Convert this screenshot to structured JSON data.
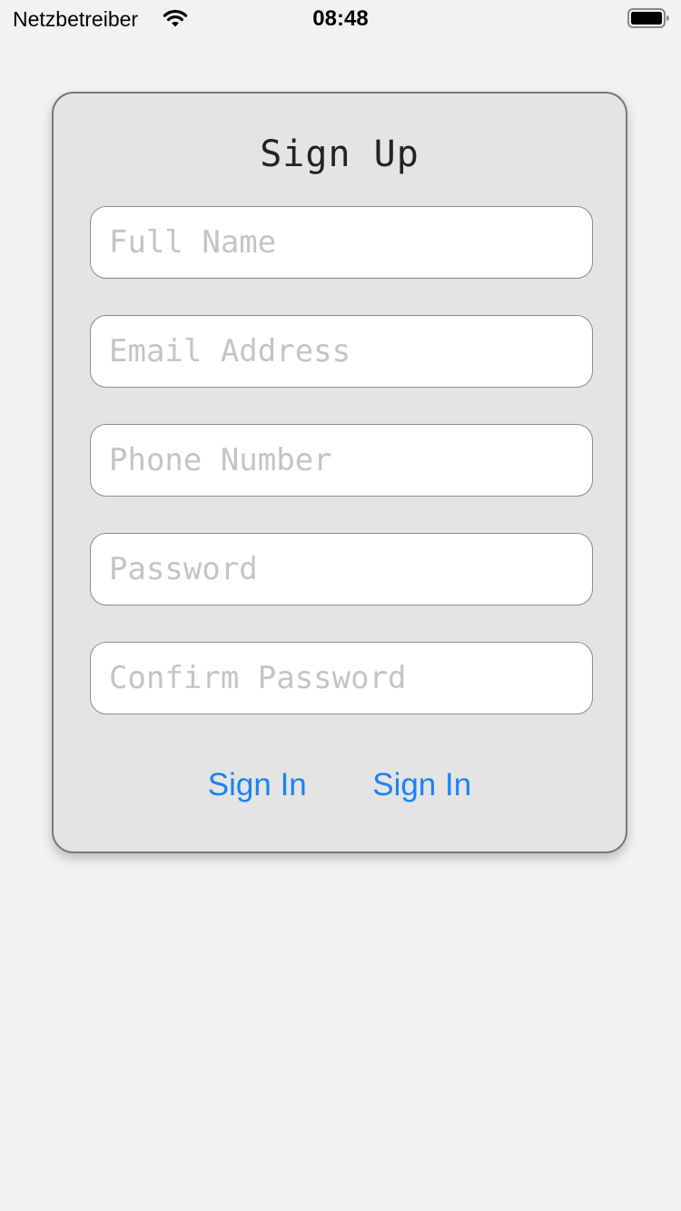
{
  "status_bar": {
    "carrier": "Netzbetreiber",
    "time": "08:48",
    "wifi_icon": "wifi-icon",
    "battery_icon": "battery-icon",
    "battery_level": 1.0
  },
  "form": {
    "title": "Sign Up",
    "fields": [
      {
        "placeholder": "Full Name",
        "value": ""
      },
      {
        "placeholder": "Email Address",
        "value": ""
      },
      {
        "placeholder": "Phone Number",
        "value": ""
      },
      {
        "placeholder": "Password",
        "value": ""
      },
      {
        "placeholder": "Confirm Password",
        "value": ""
      }
    ],
    "links": [
      {
        "label": "Sign In"
      },
      {
        "label": "Sign In"
      }
    ]
  },
  "colors": {
    "background": "#f2f2f2",
    "card": "#e4e4e4",
    "link": "#1a82f7",
    "placeholder": "#c4c4c4"
  }
}
